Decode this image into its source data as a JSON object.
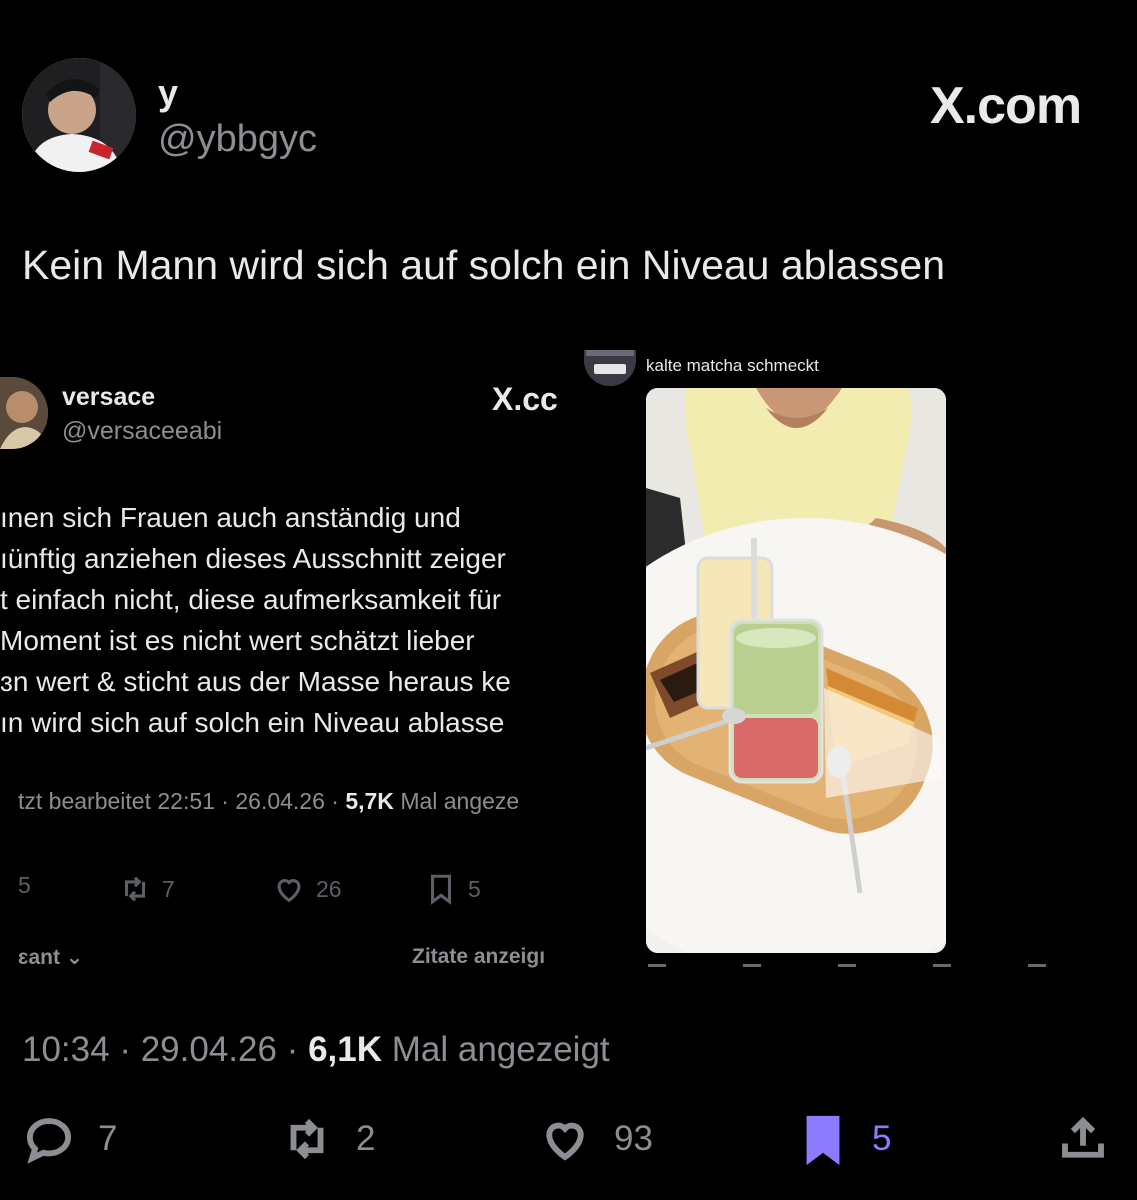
{
  "tweet": {
    "display_name": "y",
    "handle": "@ybbgyc",
    "brand": "X.com",
    "text": "Kein Mann wird sich auf solch ein Niveau ablassen",
    "time": "10:34",
    "date": "29.04.26",
    "views_count": "6,1K",
    "views_label": "Mal angezeigt",
    "stats": {
      "replies": "7",
      "reposts": "2",
      "likes": "93",
      "bookmarks": "5"
    }
  },
  "embedded_tweet": {
    "display_name": "versace",
    "handle": "@versaceeabi",
    "brand": "X.cc",
    "lines": [
      "ınen sich Frauen auch anständig und",
      "ıünftig anziehen dieses Ausschnitt zeiger",
      "t einfach nicht, diese aufmerksamkeit für",
      " Moment ist es nicht wert schätzt lieber",
      "ɜn wert & sticht aus der Masse heraus ke",
      "ın wird sich auf solch ein Niveau ablasse"
    ],
    "meta_prefix": "tzt bearbeitet 22:51 · 26.04.26 · ",
    "views_count": "5,7K",
    "views_label": "Mal angeze",
    "stats": {
      "replies": "5",
      "reposts": "7",
      "likes": "26",
      "bookmarks": "5"
    },
    "sort_label": "ɛant ⌄",
    "quotes_label": "Zitate anzeigı"
  },
  "story": {
    "caption": "kalte matcha schmeckt"
  },
  "colors": {
    "accent": "#8c7bff",
    "background": "#000000",
    "muted": "#8b8f94"
  },
  "icons": [
    "reply-icon",
    "repost-icon",
    "like-icon",
    "bookmark-icon",
    "share-icon"
  ]
}
